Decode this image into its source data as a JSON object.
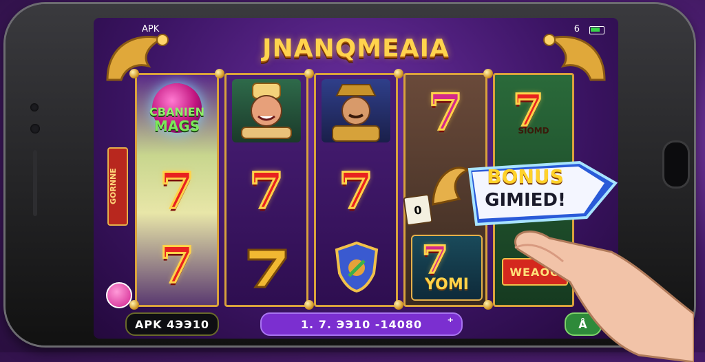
{
  "game": {
    "title": "JNANQMEAIA",
    "status_left": "APK",
    "status_right": "6",
    "reel1_top_line1": "CBANIEN",
    "reel1_top_line2": "MAGS",
    "reel1_side_label": "GORNNE",
    "tile_a_label": "0",
    "reel4_top_caption": "SIOMD",
    "bonus_line1": "BONUS",
    "bonus_line2": "GIMIED!",
    "yomi_label": "YOMI",
    "weaoo_label": "WEAOO",
    "seven_glyph": "7"
  },
  "footer": {
    "apk_badge": "APK  4ЭЭ10",
    "balance_badge": "1. 7. ЭЭ10 -14080",
    "balance_icon": "⁺",
    "right_button": "Å"
  },
  "colors": {
    "accent_gold": "#d9a23c",
    "seven_red": "#e8221f",
    "footer_purple": "#7b2fd0",
    "footer_green": "#2e8a3a"
  }
}
